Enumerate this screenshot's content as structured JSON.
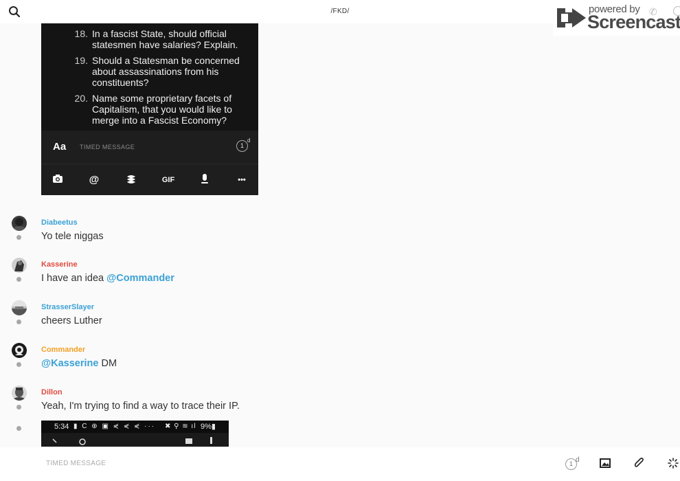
{
  "header": {
    "channel_title": "/FKD/"
  },
  "watermark": {
    "powered_by": "powered by",
    "brand": "Screencastify"
  },
  "shared_screenshot": {
    "questions": [
      {
        "num": "18.",
        "text": "In a fascist State, should official statesmen have salaries? Explain."
      },
      {
        "num": "19.",
        "text": "Should a Statesman be concerned about assassinations from his constituents?"
      },
      {
        "num": "20.",
        "text": "Name some proprietary facets of Capitalism, that you would like to merge into a Fascist Economy?"
      }
    ],
    "compose": {
      "aa_label": "Aa",
      "placeholder": "TIMED MESSAGE",
      "timer_value": "1",
      "timer_unit": "d"
    },
    "toolbar": {
      "gif_label": "GIF",
      "more_label": "•••"
    }
  },
  "messages": [
    {
      "user": "Diabeetus",
      "color": "#3ba1d6",
      "text": "Yo tele niggas"
    },
    {
      "user": "Kasserine",
      "color": "#e04b3f",
      "text": "I have an idea ",
      "mention": "@Commander"
    },
    {
      "user": "StrasserSlayer",
      "color": "#3ba1d6",
      "text": "cheers Luther"
    },
    {
      "user": "Commander",
      "color": "#f2a026",
      "mention": "@Kasserine",
      "text": " DM"
    },
    {
      "user": "Dillon",
      "color": "#e04b3f",
      "text": "Yeah, I'm trying to find a way to trace their IP."
    }
  ],
  "image_message": {
    "status_time": "5:34",
    "status_icons": "▮ C ⊕ ▣ ⋞ ⋞ ⋞ ···",
    "status_right": "✖ ⚲ ≋ ıl",
    "battery": "9%▮"
  },
  "composer": {
    "placeholder": "TIMED MESSAGE",
    "timer_value": "1",
    "timer_unit": "d"
  },
  "colors": {
    "mention": "#3ba1d6",
    "background": "#fafafa"
  }
}
